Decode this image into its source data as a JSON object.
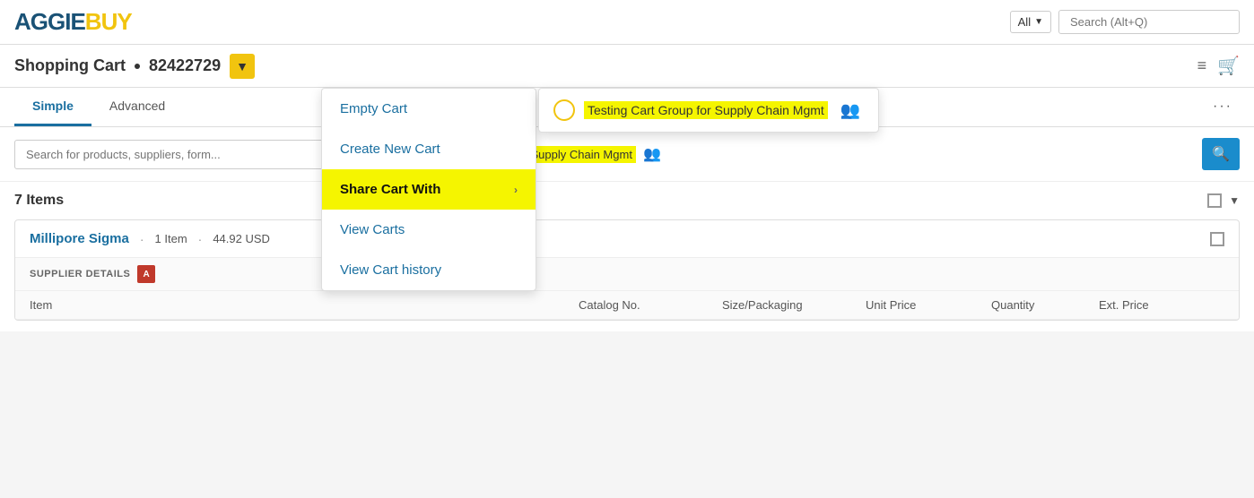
{
  "header": {
    "logo_aggie": "AGGIE",
    "logo_buy": "BUY",
    "search_dropdown": "All",
    "search_placeholder": "Search (Alt+Q)"
  },
  "subheader": {
    "cart_label": "Shopping Cart",
    "cart_number": "82422729",
    "hamburger": "≡",
    "cart_icon": "🛒"
  },
  "tabs": {
    "simple": "Simple",
    "advanced": "Advanced",
    "more": "···"
  },
  "search": {
    "placeholder": "Search for products, suppliers, form...",
    "cart_group_text": "Testing Cart Group for Supply Chain Mgmt"
  },
  "dropdown": {
    "items": [
      {
        "label": "Empty Cart",
        "highlighted": false,
        "has_arrow": false
      },
      {
        "label": "Create New Cart",
        "highlighted": false,
        "has_arrow": false
      },
      {
        "label": "Share Cart With",
        "highlighted": true,
        "has_arrow": true
      },
      {
        "label": "View Carts",
        "highlighted": false,
        "has_arrow": false
      },
      {
        "label": "View Cart history",
        "highlighted": false,
        "has_arrow": false
      }
    ]
  },
  "items": {
    "count_label": "7 Items"
  },
  "supplier": {
    "name": "Millipore Sigma",
    "item_count": "1 Item",
    "price": "44.92 USD",
    "details_label": "SUPPLIER DETAILS"
  },
  "table": {
    "columns": [
      "Item",
      "Catalog No.",
      "Size/Packaging",
      "Unit Price",
      "Quantity",
      "Ext. Price"
    ]
  },
  "colors": {
    "blue": "#1a6fa0",
    "yellow": "#f1c40f",
    "highlight_yellow": "#f5f500",
    "dark_blue": "#1a5276"
  }
}
